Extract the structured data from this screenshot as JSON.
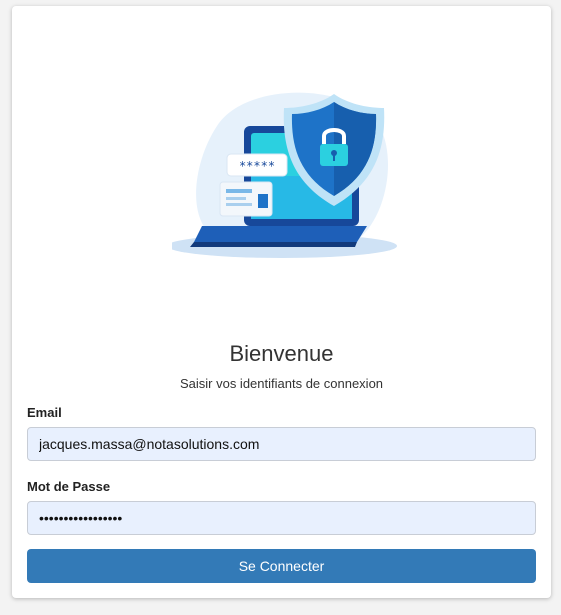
{
  "login": {
    "title": "Bienvenue",
    "subtitle": "Saisir vos identifiants de connexion",
    "email_label": "Email",
    "email_value": "jacques.massa@notasolutions.com",
    "password_label": "Mot de Passe",
    "password_value": "•••••••••••••••••",
    "submit_label": "Se Connecter",
    "illustration_icon": "laptop-security-shield-icon",
    "illustration_password_mask": "*****"
  },
  "colors": {
    "accent": "#337ab7",
    "input_bg": "#e8f0fe",
    "shield": "#1e73c8",
    "screen": "#2bd0e0"
  }
}
